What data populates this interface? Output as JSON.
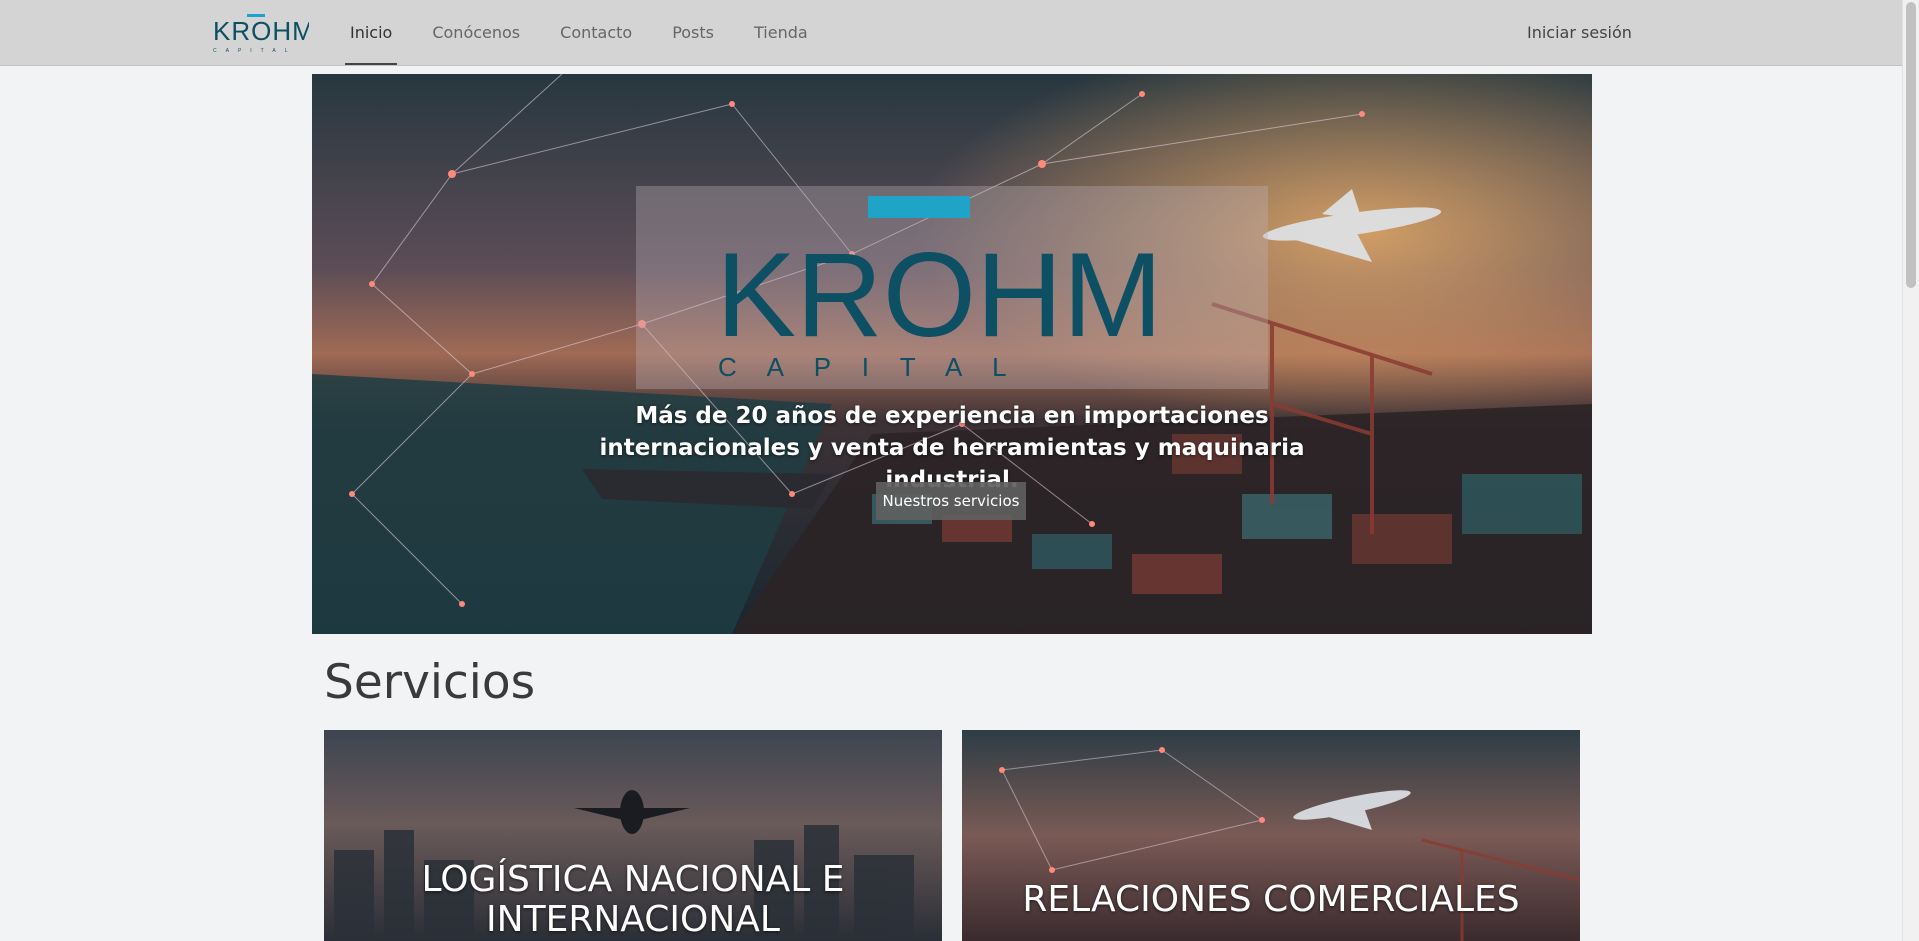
{
  "navbar": {
    "brand_name": "KROHM",
    "brand_sub": "CAPITAL",
    "links": [
      {
        "label": "Inicio",
        "active": true
      },
      {
        "label": "Conócenos",
        "active": false
      },
      {
        "label": "Contacto",
        "active": false
      },
      {
        "label": "Posts",
        "active": false
      },
      {
        "label": "Tienda",
        "active": false
      }
    ],
    "login_label": "Iniciar sesión"
  },
  "hero": {
    "logo_text": "KROHM",
    "logo_sub": "C A P I T A L",
    "tagline": "Más de 20 años de experiencia en importaciones internacionales y venta de herramientas y maquinaria industrial.",
    "button_label": "Nuestros servicios"
  },
  "services": {
    "title": "Servicios",
    "cards": [
      {
        "title": "LOGÍSTICA NACIONAL E INTERNACIONAL"
      },
      {
        "title": "RELACIONES COMERCIALES"
      }
    ]
  },
  "colors": {
    "logo_teal": "#0d4f63",
    "logo_accent": "#1fa3c7",
    "navbar_bg": "#d4d4d4",
    "page_bg": "#f2f3f5"
  }
}
